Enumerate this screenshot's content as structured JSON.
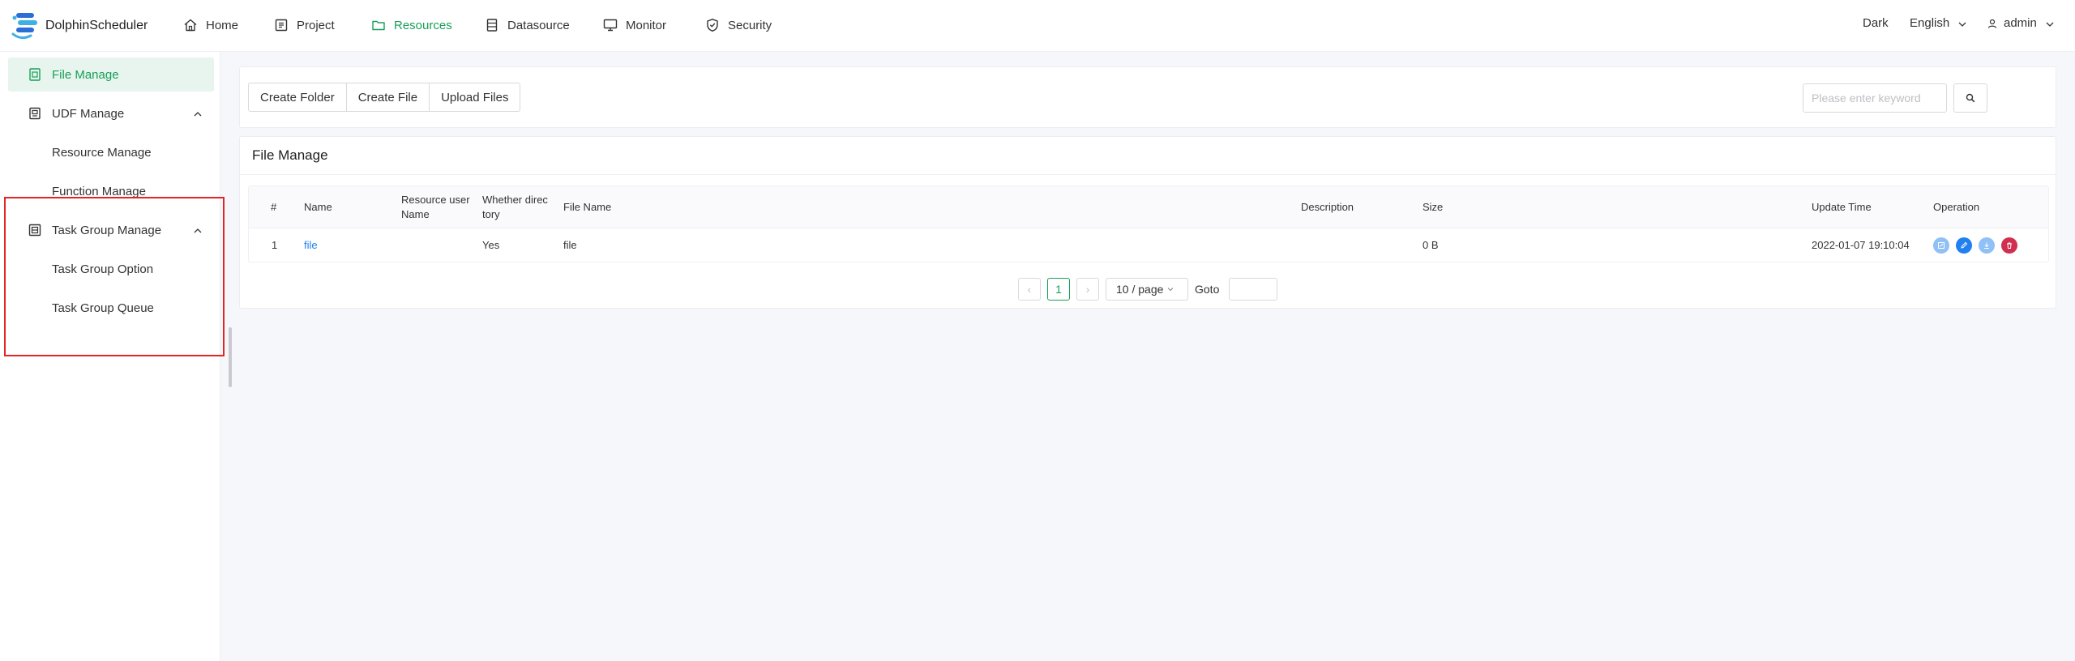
{
  "brand": {
    "name": "DolphinScheduler"
  },
  "nav": {
    "items": [
      {
        "label": "Home",
        "icon": "home-icon"
      },
      {
        "label": "Project",
        "icon": "project-icon"
      },
      {
        "label": "Resources",
        "icon": "folder-icon",
        "active": true
      },
      {
        "label": "Datasource",
        "icon": "database-icon"
      },
      {
        "label": "Monitor",
        "icon": "monitor-icon"
      },
      {
        "label": "Security",
        "icon": "shield-icon"
      }
    ],
    "theme": "Dark",
    "language": "English",
    "user": "admin"
  },
  "sidebar": {
    "items": [
      {
        "label": "File Manage",
        "active": true
      },
      {
        "label": "UDF Manage"
      },
      {
        "label": "Resource Manage"
      },
      {
        "label": "Function Manage"
      },
      {
        "label": "Task Group Manage"
      },
      {
        "label": "Task Group Option"
      },
      {
        "label": "Task Group Queue"
      }
    ]
  },
  "toolbar": {
    "create_folder": "Create Folder",
    "create_file": "Create File",
    "upload_files": "Upload Files",
    "search_placeholder": "Please enter keyword"
  },
  "card": {
    "title": "File Manage"
  },
  "table": {
    "headers": {
      "index": "#",
      "name": "Name",
      "resource_user_1": "Resource user",
      "resource_user_2": "Name",
      "directory_1": "Whether direc",
      "directory_2": "tory",
      "file_name": "File Name",
      "description": "Description",
      "size": "Size",
      "update_time": "Update Time",
      "operation": "Operation"
    },
    "rows": [
      {
        "index": "1",
        "name": "file",
        "resource_user": "",
        "directory": "Yes",
        "file_name": "file",
        "description": "",
        "size": "0 B",
        "update_time": "2022-01-07 19:10:04"
      }
    ]
  },
  "pagination": {
    "prev": "‹",
    "current_page": "1",
    "next": "›",
    "page_size": "10 / page",
    "goto_label": "Goto"
  },
  "colors": {
    "accent": "#18a058",
    "link": "#2080f0",
    "danger": "#d03050",
    "highlight_box": "#e52424"
  }
}
